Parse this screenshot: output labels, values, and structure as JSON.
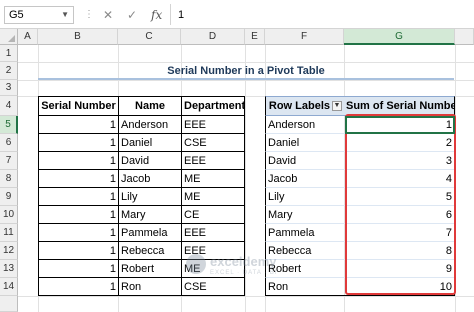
{
  "formula_bar": {
    "name_box": "G5",
    "cancel_icon": "✕",
    "enter_icon": "✓",
    "fx_label": "fx",
    "value": "1"
  },
  "columns": [
    "A",
    "B",
    "C",
    "D",
    "E",
    "F",
    "G"
  ],
  "selected_column": "G",
  "rows": [
    "1",
    "2",
    "3",
    "4",
    "5",
    "6",
    "7",
    "8",
    "9",
    "10",
    "11",
    "12",
    "13",
    "14"
  ],
  "selected_row": "5",
  "title": "Serial Number in a Pivot Table",
  "source_table": {
    "headers": [
      "Serial Number",
      "Name",
      "Department"
    ],
    "rows": [
      [
        "1",
        "Anderson",
        "EEE"
      ],
      [
        "1",
        "Daniel",
        "CSE"
      ],
      [
        "1",
        "David",
        "EEE"
      ],
      [
        "1",
        "Jacob",
        "ME"
      ],
      [
        "1",
        "Lily",
        "ME"
      ],
      [
        "1",
        "Mary",
        "CE"
      ],
      [
        "1",
        "Pammela",
        "EEE"
      ],
      [
        "1",
        "Rebecca",
        "EEE"
      ],
      [
        "1",
        "Robert",
        "ME"
      ],
      [
        "1",
        "Ron",
        "CSE"
      ]
    ]
  },
  "pivot_table": {
    "headers": [
      "Row Labels",
      "Sum of Serial Number"
    ],
    "rows": [
      [
        "Anderson",
        "1"
      ],
      [
        "Daniel",
        "2"
      ],
      [
        "David",
        "3"
      ],
      [
        "Jacob",
        "4"
      ],
      [
        "Lily",
        "5"
      ],
      [
        "Mary",
        "6"
      ],
      [
        "Pammela",
        "7"
      ],
      [
        "Rebecca",
        "8"
      ],
      [
        "Robert",
        "9"
      ],
      [
        "Ron",
        "10"
      ]
    ]
  },
  "watermark": {
    "text": "exceldemy",
    "sub": "EXCEL · DATA · BI"
  },
  "colors": {
    "accent_green": "#217346",
    "highlight_red": "#e03a3a",
    "pivot_header_bg": "#dce6f1"
  }
}
